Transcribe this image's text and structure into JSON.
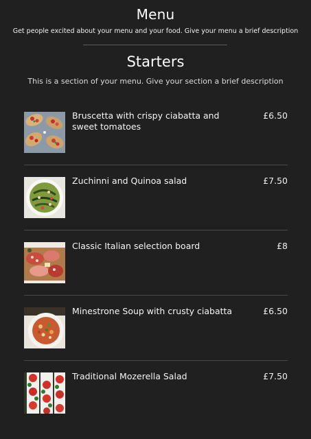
{
  "menu": {
    "title": "Menu",
    "description": "Get people excited about your menu and your food. Give your menu a brief description"
  },
  "section": {
    "title": "Starters",
    "description": "This is a section of your menu. Give your section a brief description"
  },
  "items": [
    {
      "name": "Bruscetta with crispy ciabatta and sweet tomatoes",
      "price": "£6.50",
      "image": "bruschetta-photo"
    },
    {
      "name": "Zuchinni and Quinoa salad",
      "price": "£7.50",
      "image": "zucchini-salad-photo"
    },
    {
      "name": "Classic Italian selection board",
      "price": "£8",
      "image": "charcuterie-board-photo"
    },
    {
      "name": "Minestrone Soup with crusty ciabatta",
      "price": "£6.50",
      "image": "minestrone-soup-photo"
    },
    {
      "name": "Traditional Mozerella Salad",
      "price": "£7.50",
      "image": "caprese-salad-photo"
    }
  ]
}
